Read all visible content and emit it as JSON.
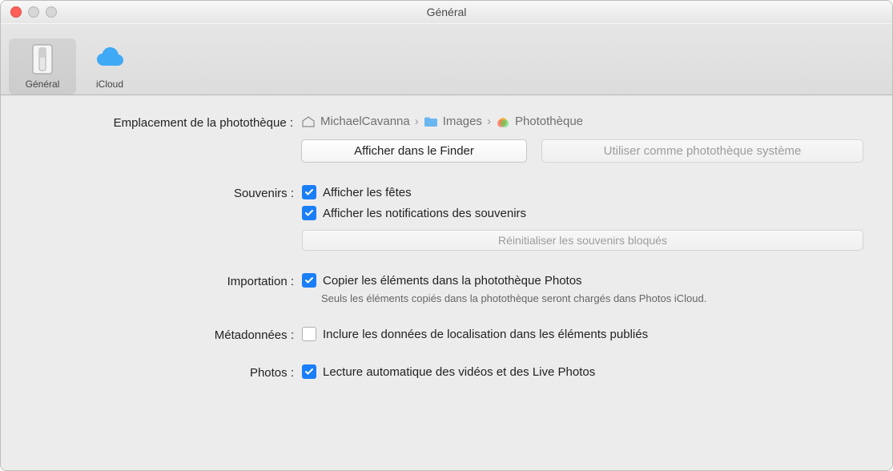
{
  "window": {
    "title": "Général"
  },
  "toolbar": {
    "general": {
      "label": "Général"
    },
    "icloud": {
      "label": "iCloud"
    }
  },
  "library_location": {
    "label": "Emplacement de la photothèque :",
    "path": [
      "MichaelCavanna",
      "Images",
      "Photothèque"
    ],
    "show_in_finder": "Afficher dans le Finder",
    "use_as_system": "Utiliser comme photothèque système"
  },
  "souvenirs": {
    "label": "Souvenirs :",
    "show_holidays": "Afficher les fêtes",
    "show_notifications": "Afficher les notifications des souvenirs",
    "reset_blocked": "Réinitialiser les souvenirs bloqués"
  },
  "importation": {
    "label": "Importation :",
    "copy_items": "Copier les éléments dans la photothèque Photos",
    "helper": "Seuls les éléments copiés dans la photothèque seront chargés dans Photos iCloud."
  },
  "metadata": {
    "label": "Métadonnées :",
    "include_location": "Inclure les données de localisation dans les éléments publiés"
  },
  "photos": {
    "label": "Photos :",
    "autoplay": "Lecture automatique des vidéos et des Live Photos"
  }
}
